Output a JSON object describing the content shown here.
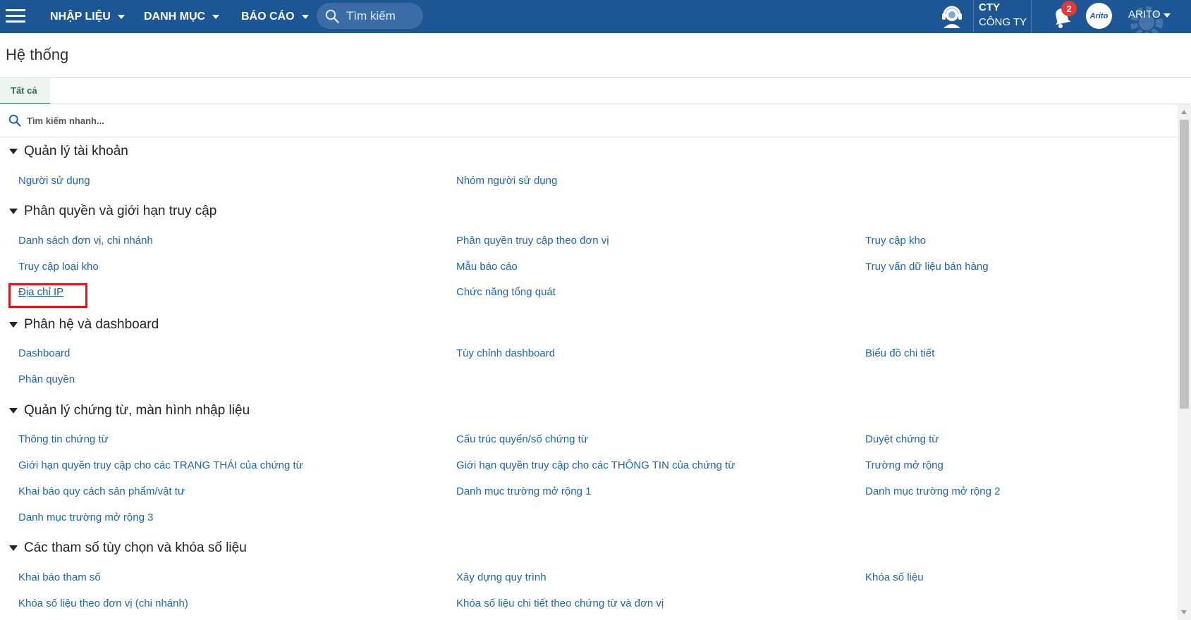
{
  "header": {
    "menus": [
      {
        "label": "NHẬP LIỆU"
      },
      {
        "label": "DANH MỤC"
      },
      {
        "label": "BÁO CÁO"
      }
    ],
    "search_placeholder": "Tìm kiếm",
    "company_code": "CTY",
    "company_name": "CÔNG TY",
    "notification_count": "2",
    "avatar_text": "Arito",
    "user_name": "ARITO"
  },
  "page": {
    "title": "Hệ thống",
    "tab_all": "Tất cả",
    "quick_search_placeholder": "Tìm kiếm nhanh..."
  },
  "sections": [
    {
      "title": "Quản lý tài khoản",
      "links": [
        "Người sử dụng",
        "Nhóm người sử dụng"
      ]
    },
    {
      "title": "Phân quyền và giới hạn truy cập",
      "links": [
        "Danh sách đơn vị, chi nhánh",
        "Phân quyền truy cập theo đơn vị",
        "Truy cập kho",
        "Truy cập loại kho",
        "Mẫu báo cáo",
        "Truy vấn dữ liệu bán hàng",
        "Địa chỉ IP",
        "Chức năng tổng quát"
      ]
    },
    {
      "title": "Phân hệ và dashboard",
      "links": [
        "Dashboard",
        "Tùy chỉnh dashboard",
        "Biểu đồ chi tiết",
        "Phân quyền"
      ]
    },
    {
      "title": "Quản lý chứng từ, màn hình nhập liệu",
      "links": [
        "Thông tin chứng từ",
        "Cấu trúc quyển/số chứng từ",
        "Duyệt chứng từ",
        "Giới hạn quyền truy cập cho các TRẠNG THÁI của chứng từ",
        "Giới hạn quyền truy cập cho các THÔNG TIN của chứng từ",
        "Trường mở rộng",
        "Khai báo quy cách sản phẩm/vật tư",
        "Danh mục trường mở rộng 1",
        "Danh mục trường mở rộng 2",
        "Danh mục trường mở rộng 3"
      ]
    },
    {
      "title": "Các tham số tùy chọn và khóa số liệu",
      "links": [
        "Khai báo tham số",
        "Xây dựng quy trình",
        "Khóa số liệu",
        "Khóa số liệu theo đơn vị (chi nhánh)",
        "Khóa số liệu chi tiết theo chứng từ và đơn vị"
      ]
    }
  ],
  "colors": {
    "topbar": "#1c5695",
    "link": "#1a66b5",
    "highlight": "#e0141a",
    "badge": "#e53935"
  }
}
